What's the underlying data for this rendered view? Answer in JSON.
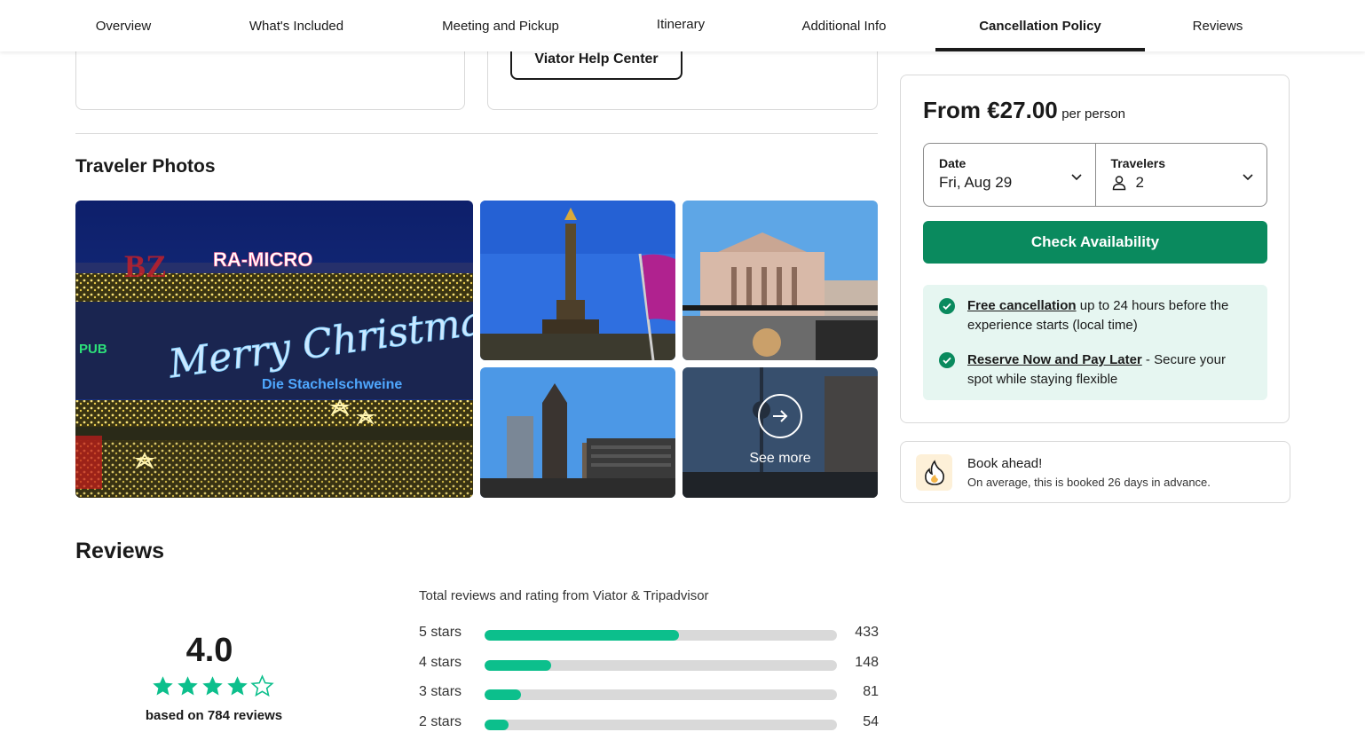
{
  "nav": {
    "tabs": [
      {
        "label": "Overview"
      },
      {
        "label": "What's Included"
      },
      {
        "label": "Meeting and Pickup"
      },
      {
        "label": "Itinerary"
      },
      {
        "label": "Additional Info"
      },
      {
        "label": "Cancellation Policy",
        "active": true
      },
      {
        "label": "Reviews"
      }
    ]
  },
  "help": {
    "button_label": "Viator Help Center"
  },
  "photos": {
    "title": "Traveler Photos",
    "see_more_label": "See more",
    "images": [
      {
        "subject": "Illuminated building facade with Merry Christmas neon sign",
        "sign_text": "Merry Christmas",
        "sub_sign": "Die Stachelschweine",
        "top_sign": "RA-MICRO"
      },
      {
        "subject": "Victory Column against blue sky"
      },
      {
        "subject": "Historic building seen from open-top bus"
      },
      {
        "subject": "Kaiser Wilhelm Memorial Church and modern towers"
      },
      {
        "subject": "TV tower silhouette behind buildings"
      }
    ]
  },
  "reviews": {
    "title": "Reviews",
    "score": "4.0",
    "stars_filled": 4,
    "stars_total": 5,
    "based_on": "based on 784 reviews",
    "total_label": "Total reviews and rating from Viator & Tripadvisor",
    "breakdown": [
      {
        "label": "5 stars",
        "count": "433",
        "fraction": 0.552
      },
      {
        "label": "4 stars",
        "count": "148",
        "fraction": 0.189
      },
      {
        "label": "3 stars",
        "count": "81",
        "fraction": 0.103
      },
      {
        "label": "2 stars",
        "count": "54",
        "fraction": 0.069
      }
    ]
  },
  "booking": {
    "price_prefix": "From €27.00",
    "price_suffix": "per person",
    "date": {
      "title": "Date",
      "value": "Fri, Aug 29"
    },
    "travelers": {
      "title": "Travelers",
      "value": "2"
    },
    "check_label": "Check Availability",
    "perks": [
      {
        "link": "Free cancellation",
        "text": " up to 24 hours before the experience starts (local time)"
      },
      {
        "link": "Reserve Now and Pay Later",
        "text": " - Secure your spot while staying flexible"
      }
    ]
  },
  "ahead": {
    "title": "Book ahead!",
    "subtitle": "On average, this is booked 26 days in advance."
  },
  "colors": {
    "primary_green": "#0a8a5e",
    "star_green": "#0cbf8c",
    "perk_bg": "#e6f6f1"
  }
}
